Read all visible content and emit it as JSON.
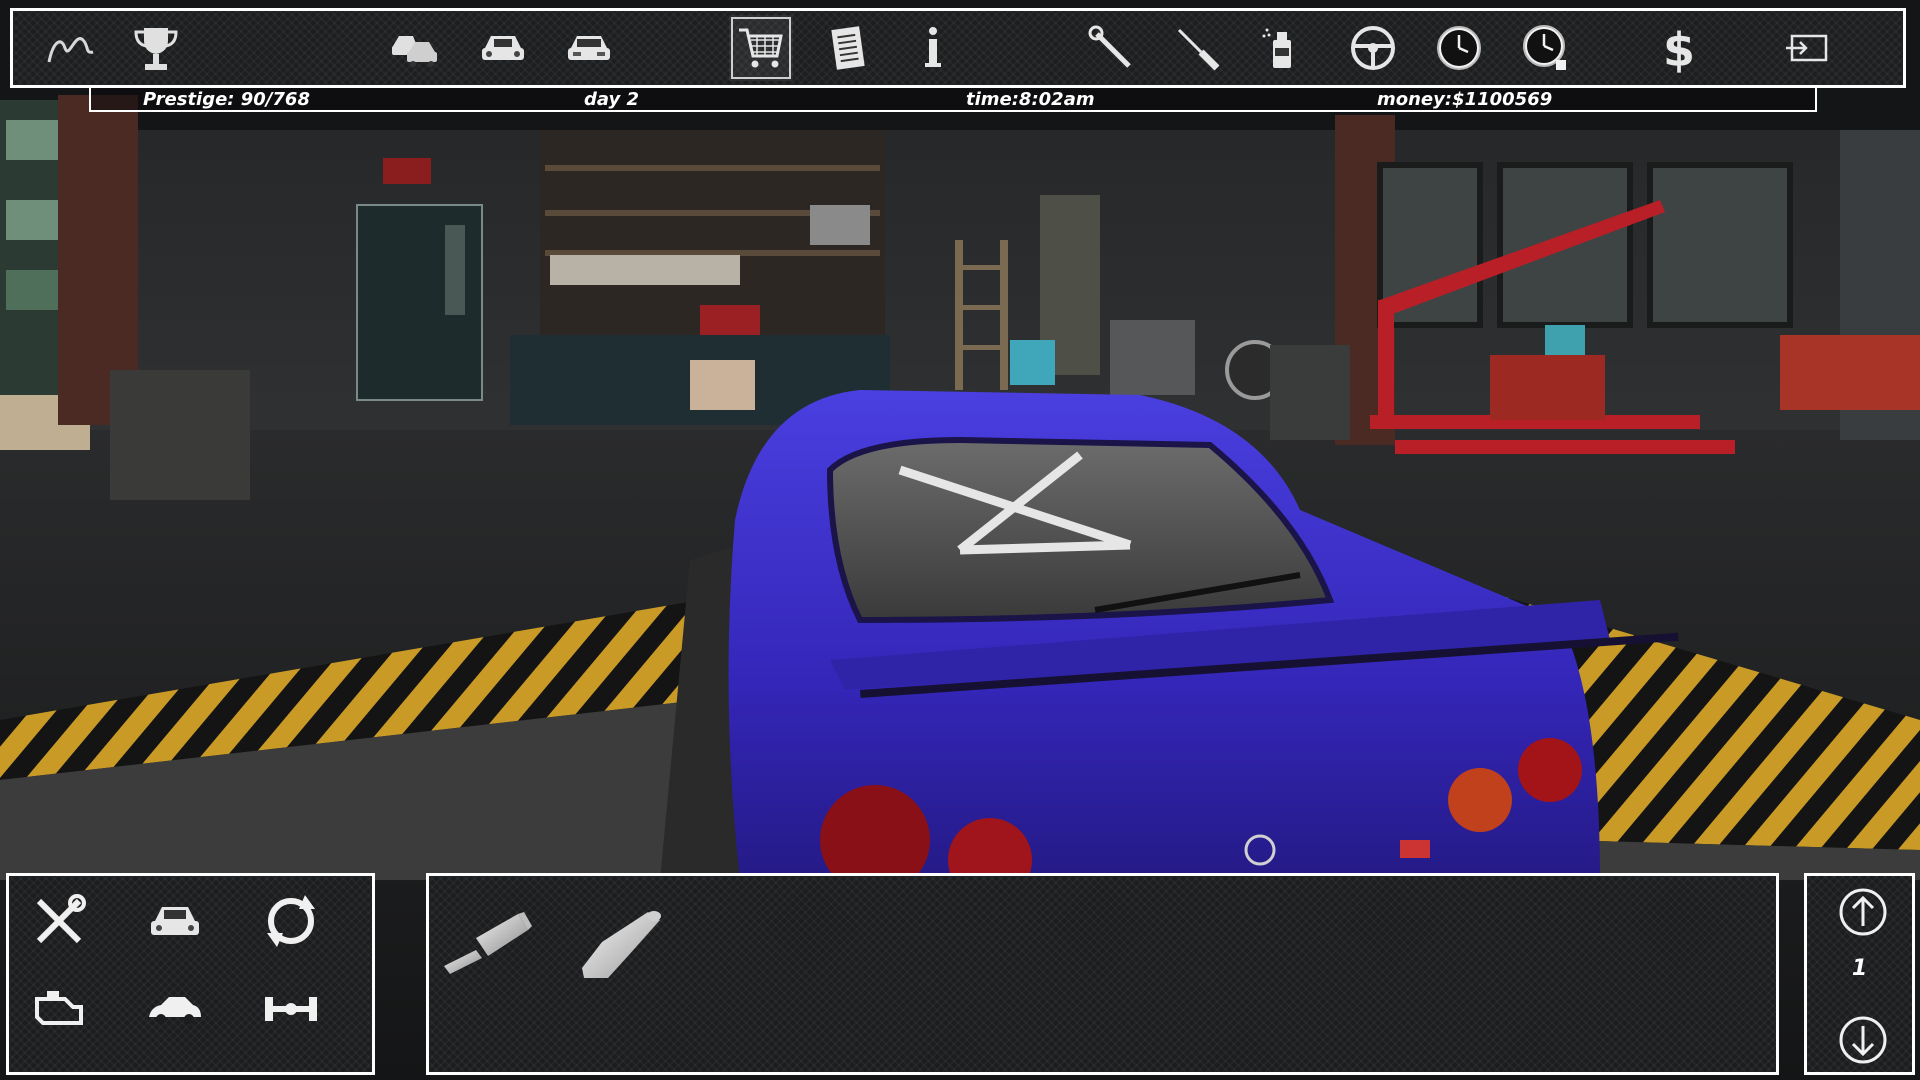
{
  "status": {
    "prestige": "Prestige: 90/768",
    "day": "day 2",
    "time": "time:8:02am",
    "money": "money:$1100569"
  },
  "toolbar": {
    "items": [
      "track-icon",
      "trophy-icon",
      "car-dealer-icon",
      "my-cars-icon",
      "car-front-icon",
      "shop-cart-icon",
      "jobs-list-icon",
      "info-icon",
      "wrench-icon",
      "screwdriver-icon",
      "paint-spray-icon",
      "steering-wheel-icon",
      "clock-icon",
      "timer-icon",
      "dollar-icon",
      "exit-icon"
    ],
    "active": "shop-cart-icon"
  },
  "categories": [
    "tools-icon",
    "car-body-icon",
    "rotate-icon",
    "engine-icon",
    "car-shell-icon",
    "axle-icon"
  ],
  "parts": [
    "exhaust-muffler-icon",
    "exhaust-tip-icon"
  ],
  "nav": {
    "page": "1"
  },
  "colors": {
    "car": "#3b2ec4",
    "hazard": "#d8a629",
    "crane": "#c0202a",
    "ui_border": "#ffffff"
  }
}
